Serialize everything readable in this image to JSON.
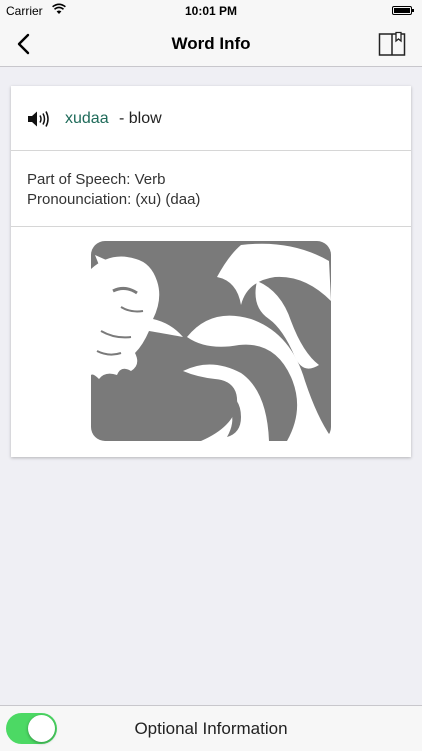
{
  "status_bar": {
    "carrier": "Carrier",
    "time": "10:01 PM"
  },
  "nav": {
    "title": "Word Info",
    "back_icon": "chevron-left-icon",
    "book_icon": "book-icon"
  },
  "word": {
    "term": "xudaa",
    "meaning": "- blow",
    "speaker_icon": "speaker-icon"
  },
  "info": {
    "part_of_speech": "Part of Speech: Verb",
    "pronunciation": "Pronounciation: (xu) (daa)"
  },
  "illustration": {
    "subject": "wind-blowing-illustration",
    "background_color": "#7a7a7a"
  },
  "bottom": {
    "toggle_on": true,
    "toggle_color": "#4cd964",
    "label": "Optional Information"
  }
}
